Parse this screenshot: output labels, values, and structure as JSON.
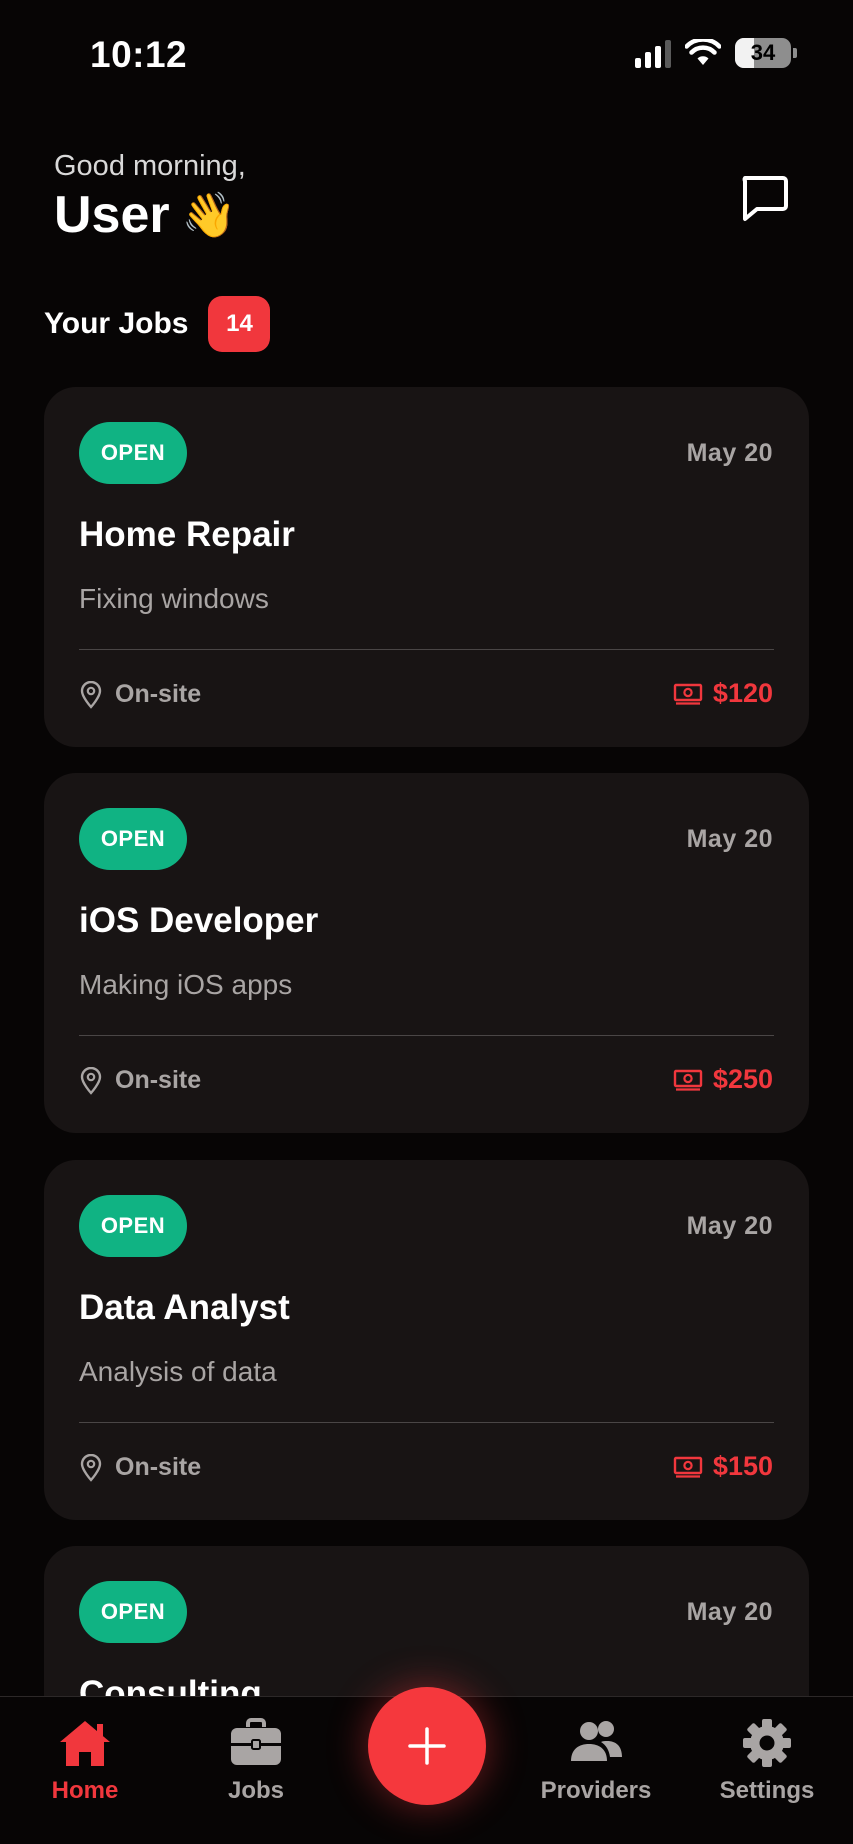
{
  "status_bar": {
    "time": "10:12",
    "battery": "34"
  },
  "header": {
    "greeting": "Good morning,",
    "name": "User",
    "emoji": "👋",
    "chat_icon": "chat-bubble-icon"
  },
  "jobs": {
    "title": "Your Jobs",
    "count": "14",
    "items": [
      {
        "status": "OPEN",
        "date": "May 20",
        "title": "Home Repair",
        "description": "Fixing windows",
        "location": "On-site",
        "price": "$120"
      },
      {
        "status": "OPEN",
        "date": "May 20",
        "title": "iOS Developer",
        "description": "Making iOS apps",
        "location": "On-site",
        "price": "$250"
      },
      {
        "status": "OPEN",
        "date": "May 20",
        "title": "Data Analyst",
        "description": "Analysis of data",
        "location": "On-site",
        "price": "$150"
      },
      {
        "status": "OPEN",
        "date": "May 20",
        "title": "Consulting",
        "description": "",
        "location": "",
        "price": ""
      }
    ]
  },
  "tab_bar": {
    "tabs": [
      {
        "label": "Home",
        "icon": "home-icon",
        "active": true
      },
      {
        "label": "Jobs",
        "icon": "briefcase-icon",
        "active": false
      },
      {
        "label": "Providers",
        "icon": "people-icon",
        "active": false
      },
      {
        "label": "Settings",
        "icon": "gear-icon",
        "active": false
      }
    ],
    "fab_icon": "plus-icon"
  },
  "colors": {
    "accent": "#f1373d",
    "open_status": "#10b383",
    "background": "#070505",
    "card": "#181414"
  }
}
